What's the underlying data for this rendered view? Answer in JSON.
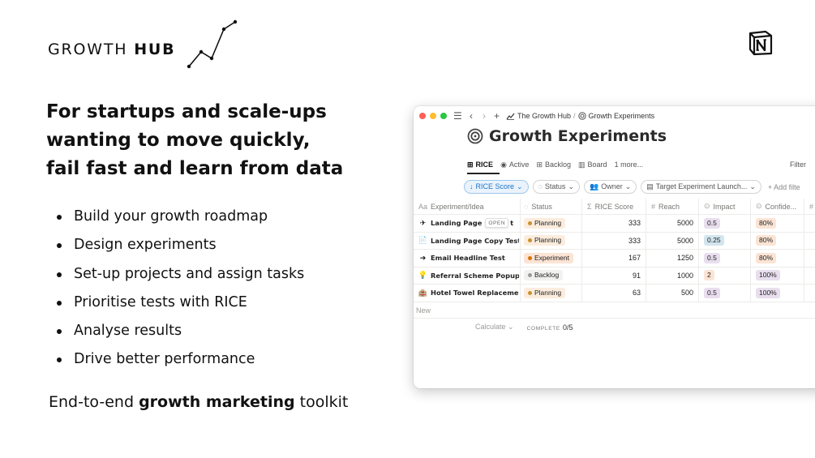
{
  "brand": {
    "text_regular": "GROWTH ",
    "text_bold": "HUB"
  },
  "headline": [
    "For startups and scale-ups",
    "wanting to move quickly,",
    "fail fast and learn from data"
  ],
  "bullets": [
    "Build your growth roadmap",
    "Design experiments",
    "Set-up projects and assign tasks",
    "Prioritise tests with RICE",
    "Analyse results",
    "Drive better performance"
  ],
  "tagline": {
    "before": "End-to-end ",
    "bold": "growth marketing",
    "after": " toolkit"
  },
  "window": {
    "breadcrumb": {
      "parent": "The Growth Hub",
      "separator": "/",
      "current": "Growth Experiments"
    },
    "page_title": "Growth Experiments",
    "views": [
      {
        "label": "RICE",
        "icon": "table-icon"
      },
      {
        "label": "Active",
        "icon": "record-icon"
      },
      {
        "label": "Backlog",
        "icon": "table-icon"
      },
      {
        "label": "Board",
        "icon": "board-icon"
      },
      {
        "label": "1 more..."
      }
    ],
    "filter_label": "Filter",
    "filters": {
      "sort": "RICE Score",
      "status": "Status",
      "owner": "Owner",
      "target": "Target Experiment Launch...",
      "add": "+ Add filte"
    },
    "columns": {
      "name": "Experiment/Idea",
      "name_icon": "Aa",
      "status": "Status",
      "rice": "RICE Score",
      "reach": "Reach",
      "impact": "Impact",
      "confidence": "Confide...",
      "more": "#"
    },
    "rows": [
      {
        "name": "Landing Page",
        "name_suffix": "t",
        "icon": "✈",
        "open_label": "OPEN",
        "status": "Planning",
        "status_class": "planning",
        "rice": "333",
        "reach": "5000",
        "impact": "0.5",
        "impact_color": "#e8deee",
        "confidence": "80%",
        "conf_color": "#fbe4d4"
      },
      {
        "name": "Landing Page Copy Test",
        "icon": "📄",
        "status": "Planning",
        "status_class": "planning",
        "rice": "333",
        "reach": "5000",
        "impact": "0.25",
        "impact_color": "#d3e5ef",
        "confidence": "80%",
        "conf_color": "#fbe4d4"
      },
      {
        "name": "Email Headline Test",
        "icon": "➔",
        "status": "Experiment",
        "status_class": "experiment",
        "rice": "167",
        "reach": "1250",
        "impact": "0.5",
        "impact_color": "#e8deee",
        "confidence": "80%",
        "conf_color": "#fbe4d4"
      },
      {
        "name": "Referral Scheme Popup",
        "icon": "💡",
        "status": "Backlog",
        "status_class": "backlog",
        "rice": "91",
        "reach": "1000",
        "impact": "2",
        "impact_color": "#fbe4d4",
        "confidence": "100%",
        "conf_color": "#e8deee"
      },
      {
        "name": "Hotel Towel Replacement",
        "icon": "🏨",
        "status": "Planning",
        "status_class": "planning",
        "rice": "63",
        "reach": "500",
        "impact": "0.5",
        "impact_color": "#e8deee",
        "confidence": "100%",
        "conf_color": "#e8deee"
      }
    ],
    "new_label": "New",
    "calculate_label": "Calculate",
    "complete_label": "COMPLETE",
    "complete_value": "0/5"
  }
}
